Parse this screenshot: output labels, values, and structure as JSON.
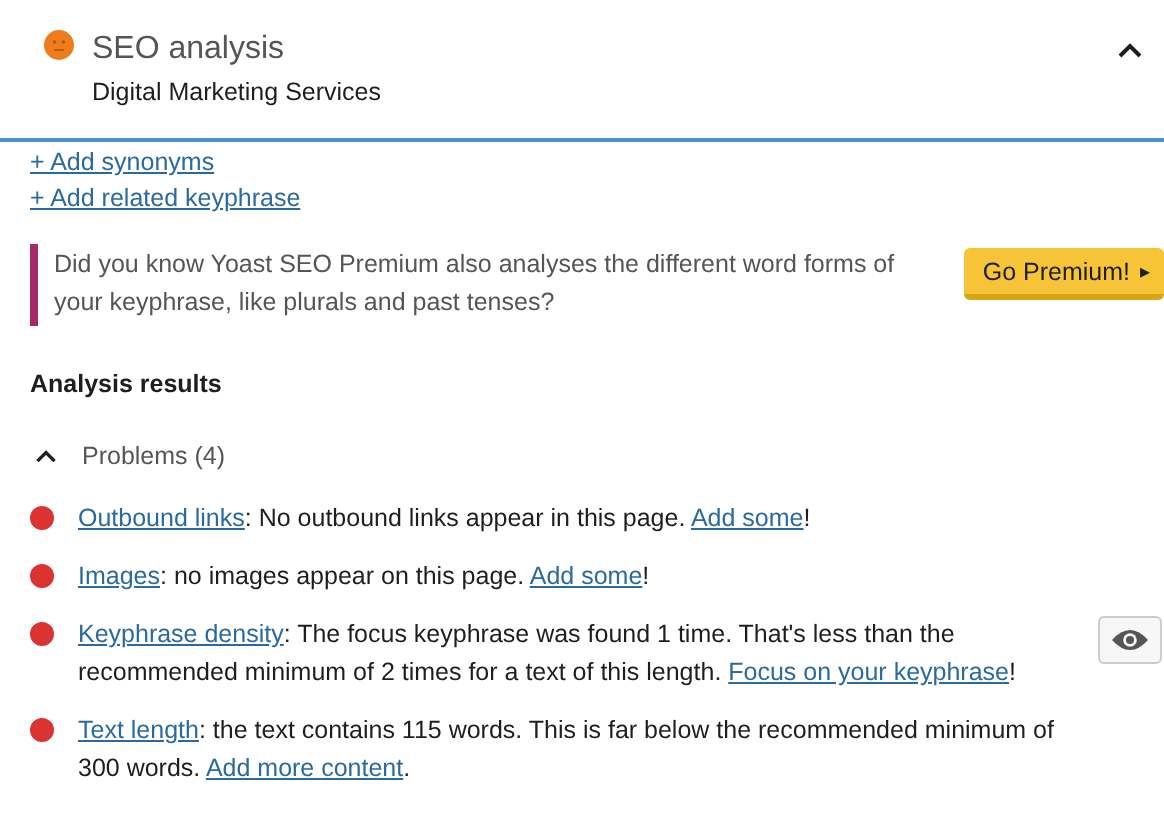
{
  "header": {
    "title": "SEO analysis",
    "subtitle": "Digital Marketing Services",
    "expanded": true
  },
  "add_links": [
    "+ Add synonyms",
    "+ Add related keyphrase"
  ],
  "premium_tip": {
    "text": "Did you know Yoast SEO Premium also analyses the different word forms of your keyphrase, like plurals and past tenses?",
    "button": "Go Premium!",
    "button_icon": "▸"
  },
  "analysis": {
    "heading": "Analysis results",
    "group": {
      "label": "Problems (4)",
      "expanded": true
    },
    "results": [
      {
        "color": "#dc3232",
        "marker_button": false,
        "parts": [
          {
            "kind": "link",
            "text": "Outbound links"
          },
          {
            "kind": "text",
            "text": ": No outbound links appear in this page. "
          },
          {
            "kind": "link",
            "text": "Add some"
          },
          {
            "kind": "text",
            "text": "!"
          }
        ]
      },
      {
        "color": "#dc3232",
        "marker_button": false,
        "parts": [
          {
            "kind": "link",
            "text": "Images"
          },
          {
            "kind": "text",
            "text": ": no images appear on this page. "
          },
          {
            "kind": "link",
            "text": "Add some"
          },
          {
            "kind": "text",
            "text": "!"
          }
        ]
      },
      {
        "color": "#dc3232",
        "marker_button": true,
        "parts": [
          {
            "kind": "link",
            "text": "Keyphrase density"
          },
          {
            "kind": "text",
            "text": ": The focus keyphrase was found 1 time. That's less than the recommended minimum of 2 times for a text of this length. "
          },
          {
            "kind": "link",
            "text": "Focus on your keyphrase"
          },
          {
            "kind": "text",
            "text": "!"
          }
        ]
      },
      {
        "color": "#dc3232",
        "marker_button": false,
        "parts": [
          {
            "kind": "link",
            "text": "Text length"
          },
          {
            "kind": "text",
            "text": ": the text contains 115 words. This is far below the recommended minimum of 300 words. "
          },
          {
            "kind": "link",
            "text": "Add more content"
          },
          {
            "kind": "text",
            "text": "."
          }
        ]
      }
    ]
  }
}
